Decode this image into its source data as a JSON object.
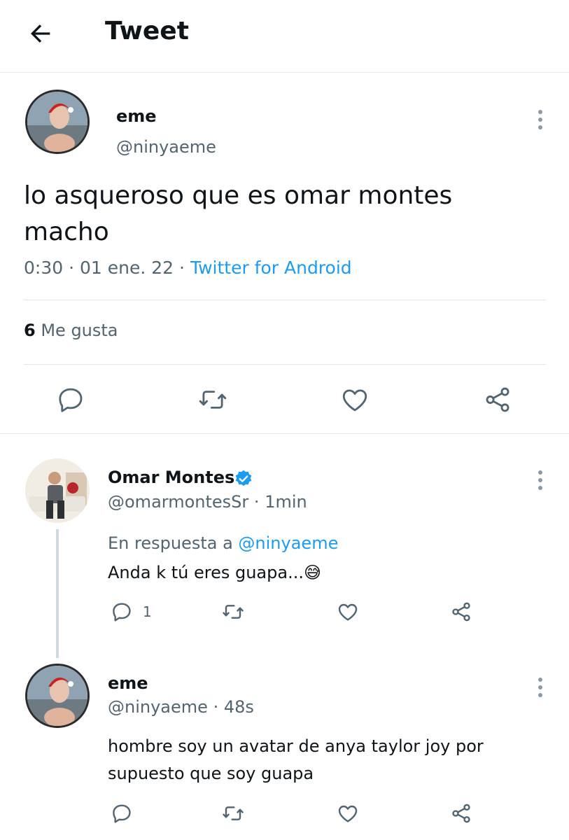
{
  "header": {
    "title": "Tweet",
    "back_icon": "arrow-left-icon"
  },
  "main_tweet": {
    "author_name": "eme",
    "author_handle": "@ninyaeme",
    "text": "lo asqueroso que es omar montes macho",
    "time": "0:30",
    "date": "01 ene. 22",
    "separator": "·",
    "source": "Twitter for Android",
    "likes_count": "6",
    "likes_label": "Me gusta",
    "actions": [
      "reply-icon",
      "retweet-icon",
      "like-icon",
      "share-icon"
    ]
  },
  "replies": [
    {
      "author_name": "Omar Montes",
      "verified": true,
      "author_handle": "@omarmontesSr",
      "time": "1min",
      "reply_prefix": "En respuesta a",
      "reply_mention": "@ninyaeme",
      "text": "Anda k tú eres guapa...",
      "emoji": "😅",
      "reply_count": "1"
    },
    {
      "author_name": "eme",
      "author_handle": "@ninyaeme",
      "time": "48s",
      "text_line1": "hombre soy un avatar de anya taylor joy por",
      "text_line2": "supuesto que soy guapa"
    }
  ],
  "colors": {
    "accent": "#1d9bf0",
    "secondary_text": "#536471",
    "divider": "#e1e8ed"
  }
}
